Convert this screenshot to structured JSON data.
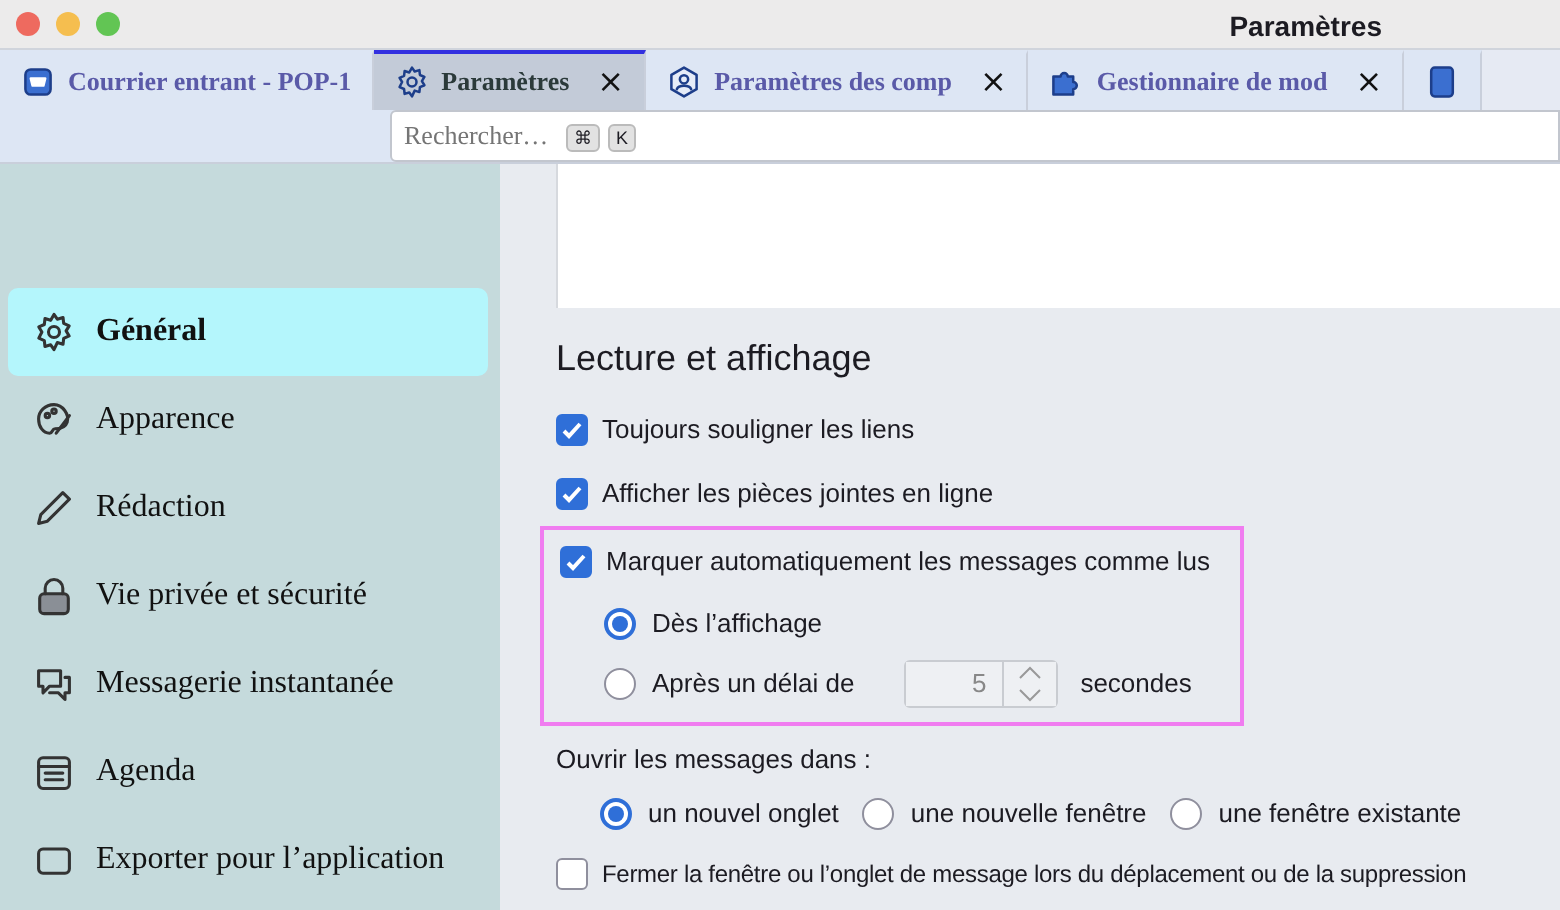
{
  "window": {
    "title": "Paramètres"
  },
  "tabs": [
    {
      "label": "Courrier entrant - POP-1",
      "selected": false
    },
    {
      "label": "Paramètres",
      "selected": true,
      "close": "×"
    },
    {
      "label": "Paramètres des comp",
      "selected": false,
      "close": "×"
    },
    {
      "label": "Gestionnaire de mod",
      "selected": false,
      "close": "×"
    },
    {
      "selected": false
    }
  ],
  "search": {
    "placeholder": "Rechercher…",
    "keys": [
      "⌘",
      "K"
    ]
  },
  "sidebar": {
    "items": [
      {
        "label": "Général",
        "selected": true
      },
      {
        "label": "Apparence",
        "selected": false
      },
      {
        "label": "Rédaction",
        "selected": false
      },
      {
        "label": "Vie privée et sécurité",
        "selected": false
      },
      {
        "label": "Messagerie instantanée",
        "selected": false
      },
      {
        "label": "Agenda",
        "selected": false
      },
      {
        "label": "Exporter pour l’application",
        "selected": false
      }
    ]
  },
  "section": {
    "title": "Lecture et affichage",
    "options": [
      {
        "kind": "checkbox",
        "label": "Toujours souligner les liens",
        "checked": true
      },
      {
        "kind": "checkbox",
        "label": "Afficher les pièces jointes en ligne",
        "checked": true
      }
    ],
    "auto_mark": {
      "highlighted": true,
      "label": "Marquer automatiquement les messages comme lus",
      "checked": true,
      "choices": [
        {
          "label": "Dès l’affichage",
          "selected": true
        },
        {
          "label": "Après un délai de",
          "selected": false,
          "delay": "5",
          "unit": "secondes",
          "disabled": true
        }
      ]
    },
    "open_in": {
      "label": "Ouvrir les messages dans :",
      "choices": [
        {
          "label": "un nouvel onglet",
          "selected": true
        },
        {
          "label": "une nouvelle fenêtre",
          "selected": false
        },
        {
          "label": "une fenêtre existante",
          "selected": false
        }
      ]
    },
    "close_option": {
      "label": "Fermer la fenêtre ou l’onglet de message lors du déplacement ou de la suppression",
      "checked": false
    }
  }
}
